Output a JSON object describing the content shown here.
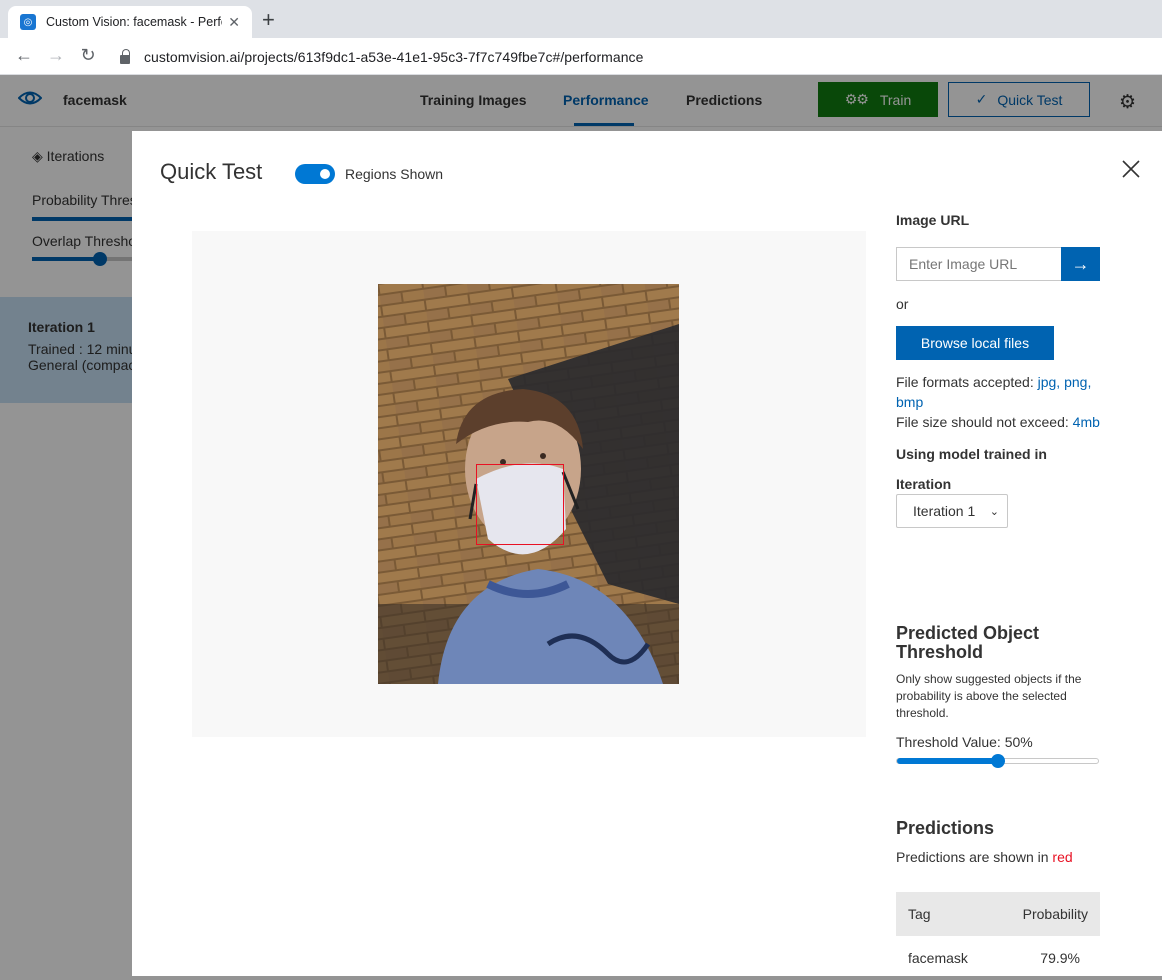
{
  "browser": {
    "tab_title": "Custom Vision: facemask - Perfor",
    "url": "customvision.ai/projects/613f9dc1-a53e-41e1-95c3-7f7c749fbe7c#/performance"
  },
  "app": {
    "project_name": "facemask",
    "nav": [
      "Training Images",
      "Performance",
      "Predictions"
    ],
    "active_nav": "Performance",
    "train_label": "Train",
    "quick_test_label": "Quick Test",
    "sidebar": {
      "iterations_label": "Iterations",
      "probability_label": "Probability Thres",
      "overlap_label": "Overlap Thresho",
      "iteration_card": {
        "title": "Iteration 1",
        "trained": "Trained : 12 minu",
        "domain": "General (compac"
      }
    }
  },
  "modal": {
    "title": "Quick Test",
    "toggle_label": "Regions Shown",
    "regions_shown": true,
    "image_url_label": "Image URL",
    "image_url_placeholder": "Enter Image URL",
    "or_label": "or",
    "browse_label": "Browse local files",
    "formats_prefix": "File formats accepted: ",
    "formats": "jpg, png, bmp",
    "size_prefix": "File size should not exceed: ",
    "size_value": "4mb",
    "model_heading": "Using model trained in",
    "iteration_label": "Iteration",
    "iteration_value": "Iteration 1",
    "threshold_title": "Predicted Object Threshold",
    "threshold_desc": "Only show suggested objects if the probability is above the selected threshold.",
    "threshold_label": "Threshold Value: 50%",
    "threshold_value": 0.5,
    "predictions_title": "Predictions",
    "predictions_note_prefix": "Predictions are shown in ",
    "predictions_note_color": "red",
    "table": {
      "headers": [
        "Tag",
        "Probability"
      ],
      "rows": [
        {
          "tag": "facemask",
          "probability": "79.9%"
        }
      ]
    }
  },
  "colors": {
    "accent": "#0063b1",
    "train_green": "#107c10",
    "region_red": "#e81123"
  }
}
